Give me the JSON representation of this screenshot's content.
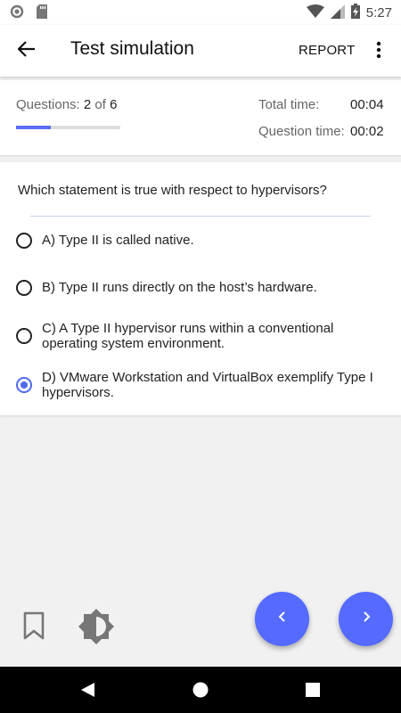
{
  "status_bar": {
    "time": "5:27",
    "icons": [
      "circle-notification-icon",
      "sd-card-icon",
      "wifi-icon",
      "signal-icon",
      "battery-charging-icon"
    ]
  },
  "app_bar": {
    "title": "Test simulation",
    "report_label": "REPORT",
    "icons": [
      "back-arrow-icon",
      "more-vert-icon"
    ]
  },
  "stats": {
    "questions_label": "Questions:",
    "current": "2",
    "of_label": "of",
    "total": "6",
    "progress_fraction": 0.333,
    "total_time_label": "Total time:",
    "total_time_value": "00:04",
    "question_time_label": "Question time:",
    "question_time_value": "00:02"
  },
  "question": {
    "text": "Which statement is true with respect to hypervisors?",
    "options": [
      {
        "label": "A) Type II is called native.",
        "selected": false
      },
      {
        "label": "B) Type II runs directly on the host’s hardware.",
        "selected": false
      },
      {
        "label": "C) A Type II hypervisor runs within a conventional operating system environment.",
        "selected": false
      },
      {
        "label": "D) VMware Workstation and VirtualBox exemplify Type I hypervisors.",
        "selected": true
      }
    ]
  },
  "bottom": {
    "icons": [
      "bookmark-icon",
      "brightness-icon",
      "prev-arrow-icon",
      "next-arrow-icon"
    ]
  },
  "colors": {
    "accent": "#556bff",
    "progress": "#5b6ef0"
  }
}
